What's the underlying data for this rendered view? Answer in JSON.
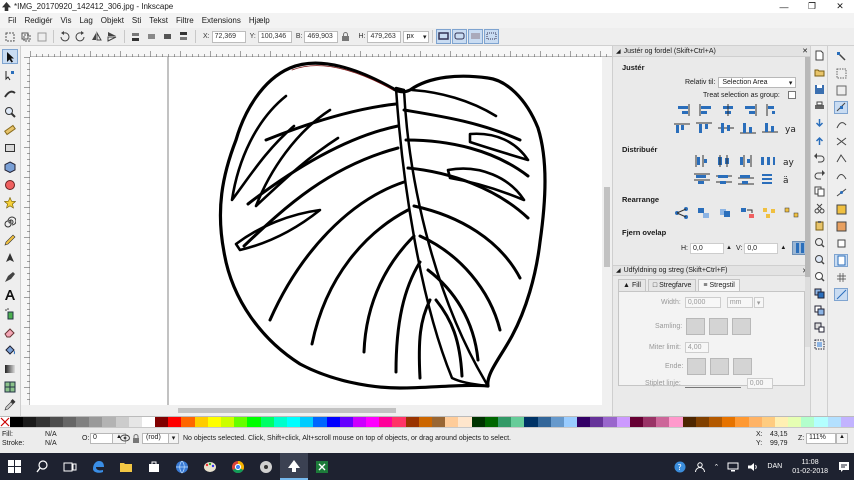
{
  "window": {
    "title": "*IMG_20170920_142412_306.jpg - Inkscape"
  },
  "menu": [
    "Fil",
    "Redigér",
    "Vis",
    "Lag",
    "Objekt",
    "Sti",
    "Tekst",
    "Filtre",
    "Extensions",
    "Hjælp"
  ],
  "toolbar": {
    "x_label": "X:",
    "x_value": "72,369",
    "y_label": "Y:",
    "y_value": "100,346",
    "w_label": "B:",
    "w_value": "469,903",
    "h_label": "H:",
    "h_value": "479,263",
    "unit": "px"
  },
  "align_panel": {
    "title": "Justér og fordel (Skift+Ctrl+A)",
    "align_label": "Justér",
    "relative_label": "Relativ til:",
    "relative_value": "Selection Area",
    "treat_group_label": "Treat selection as group:",
    "distribute_label": "Distribuér",
    "rearrange_label": "Rearrange",
    "remove_overlap_label": "Fjern ovelap",
    "h_label": "H:",
    "h_value": "0,0",
    "v_label": "V:",
    "v_value": "0,0"
  },
  "fill_stroke_panel": {
    "title": "Udfyldning og streg (Skift+Ctrl+F)",
    "tabs": [
      "Fill",
      "Stregfarve",
      "Stregstil"
    ],
    "width_label": "Width:",
    "width_value": "0,000",
    "width_unit": "mm",
    "join_label": "Samling:",
    "miter_label": "Miter limit:",
    "miter_value": "4,00",
    "cap_label": "Ende:",
    "dash_label": "Stiplet linje:",
    "dash_value": "0,00"
  },
  "status": {
    "fill_label": "Fill:",
    "fill_value": "N/A",
    "stroke_label": "Stroke:",
    "stroke_value": "N/A",
    "opacity_label": "O:",
    "opacity_value": "0",
    "layer": "(rod)",
    "message": "No objects selected. Click, Shift+click, Alt+scroll mouse on top of objects, or drag around objects to select.",
    "cursor_x_label": "X:",
    "cursor_x": "43,15",
    "cursor_y_label": "Y:",
    "cursor_y": "99,79",
    "zoom_label": "Z:",
    "zoom": "111%"
  },
  "taskbar": {
    "language": "DAN",
    "time": "11:08",
    "date": "01-02-2018"
  },
  "colors": {
    "accent_selected": "#c9dcf2",
    "taskbar": "#1e2230",
    "palette": [
      "#000000",
      "#1a1a1a",
      "#333333",
      "#4d4d4d",
      "#666666",
      "#808080",
      "#999999",
      "#b3b3b3",
      "#cccccc",
      "#e6e6e6",
      "#ffffff",
      "#800000",
      "#ff0000",
      "#ff6600",
      "#ffcc00",
      "#ffff00",
      "#ccff00",
      "#66ff00",
      "#00ff00",
      "#00ff66",
      "#00ffcc",
      "#00ffff",
      "#00ccff",
      "#0066ff",
      "#0000ff",
      "#6600ff",
      "#cc00ff",
      "#ff00ff",
      "#ff0099",
      "#ff3366",
      "#993300",
      "#cc6600",
      "#996633",
      "#ffcc99",
      "#ffe6cc",
      "#003300",
      "#006600",
      "#339966",
      "#66cc99",
      "#003366",
      "#336699",
      "#6699cc",
      "#99ccff",
      "#330066",
      "#663399",
      "#9966cc",
      "#cc99ff",
      "#660033",
      "#993366",
      "#cc6699",
      "#ff99cc",
      "#4d2600",
      "#804000",
      "#b35900",
      "#e67300",
      "#ff9933",
      "#ffb366",
      "#ffcc80",
      "#fff0b3",
      "#e6ffb3",
      "#b3ffcc",
      "#b3ffff",
      "#b3e0ff",
      "#c2b3ff"
    ]
  }
}
